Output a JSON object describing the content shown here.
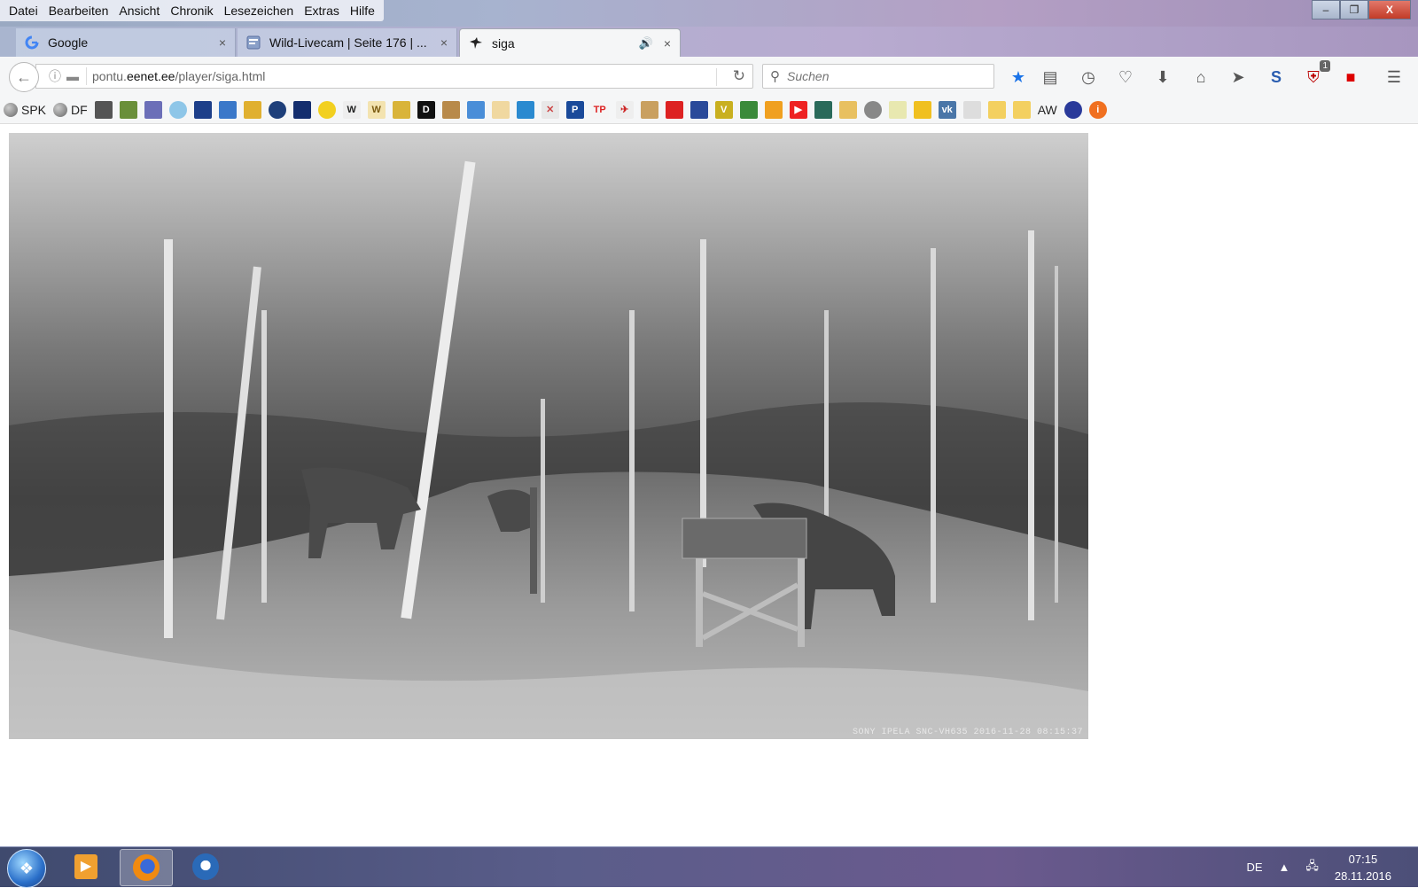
{
  "menu": {
    "items": [
      {
        "label": "Datei"
      },
      {
        "label": "Bearbeiten"
      },
      {
        "label": "Ansicht"
      },
      {
        "label": "Chronik"
      },
      {
        "label": "Lesezeichen"
      },
      {
        "label": "Extras"
      },
      {
        "label": "Hilfe"
      }
    ]
  },
  "window_controls": {
    "minimize": "–",
    "maximize": "❐",
    "close": "X"
  },
  "tabs": [
    {
      "title": "Google",
      "favicon": "google-icon",
      "close": "×"
    },
    {
      "title": "Wild-Livecam | Seite 176 | ...",
      "favicon": "forum-icon",
      "close": "×"
    },
    {
      "title": "siga",
      "favicon": "eagle-icon",
      "close": "×",
      "audio": "🔊"
    }
  ],
  "new_tab_label": "+",
  "navigation": {
    "url_prefix": "pontu.",
    "url_domain": "eenet.ee",
    "url_path": "/player/siga.html",
    "search_placeholder": "Suchen",
    "addon_badge": "1"
  },
  "bookmarks": [
    {
      "label": "SPK",
      "type": "text"
    },
    {
      "label": "DF",
      "type": "text"
    },
    {
      "label": "AW",
      "type": "text"
    }
  ],
  "video": {
    "overlay_text": "SONY IPELA SNC-VH635   2016-11-28 08:15:37"
  },
  "taskbar": {
    "language": "DE",
    "time": "07:15",
    "date": "28.11.2016"
  }
}
